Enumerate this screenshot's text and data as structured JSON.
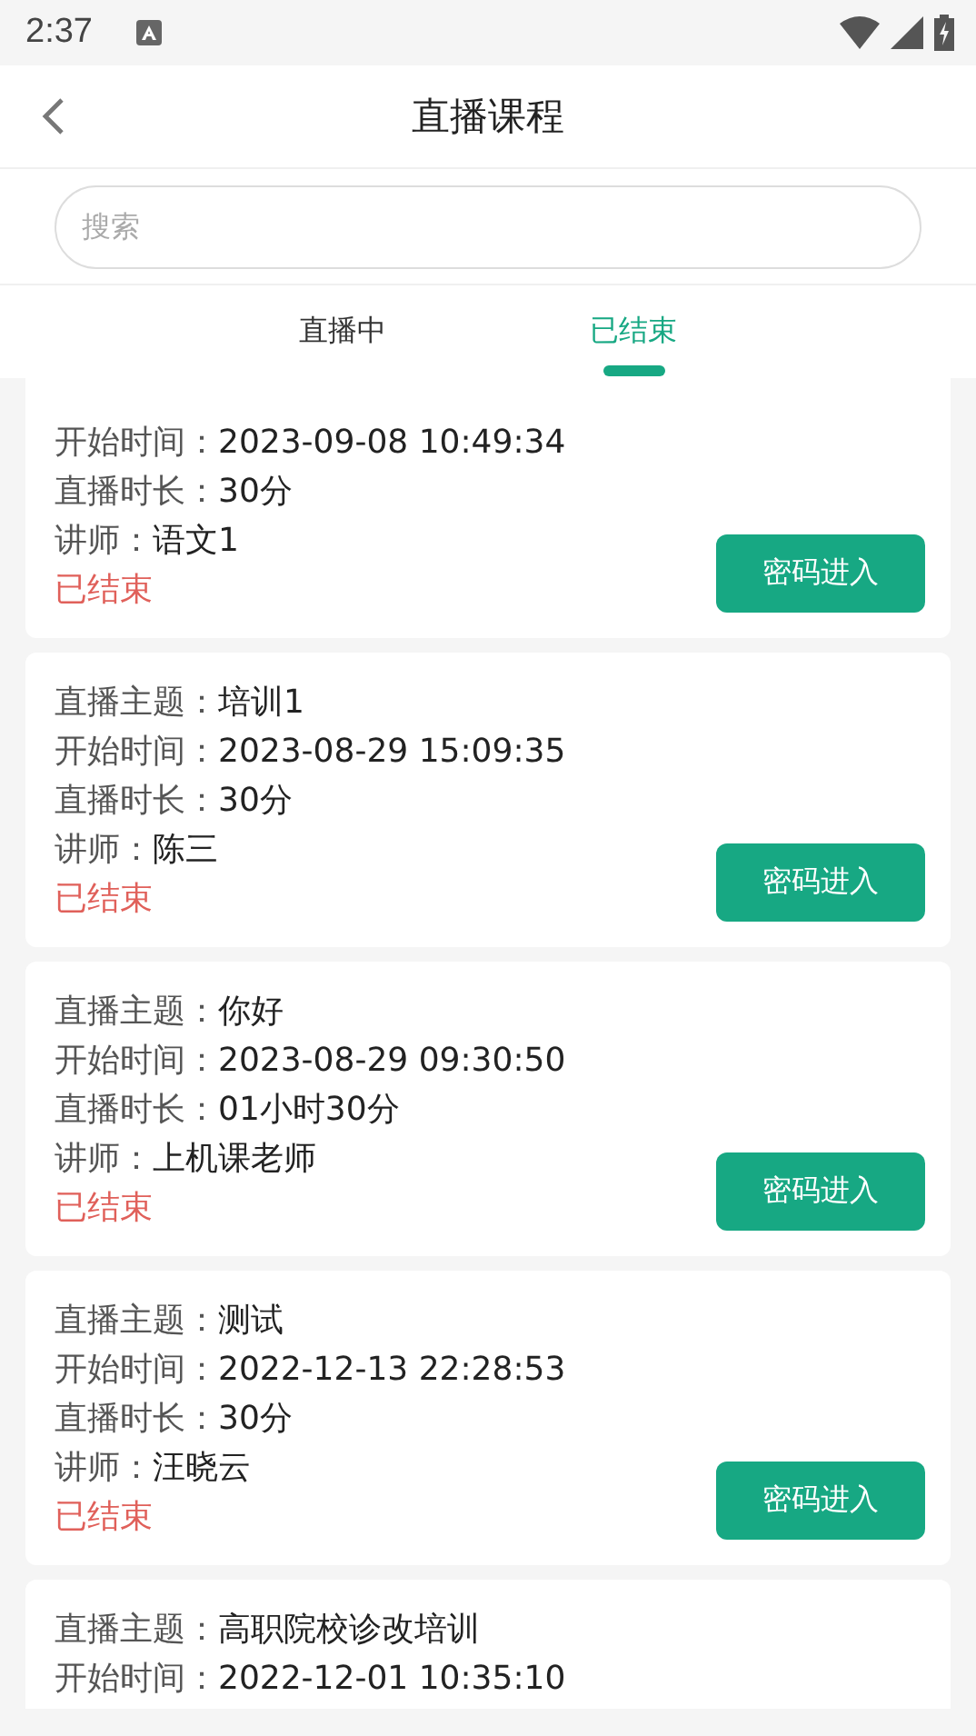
{
  "status_bar": {
    "time": "2:37"
  },
  "header": {
    "title": "直播课程"
  },
  "search": {
    "placeholder": "搜索"
  },
  "tabs": [
    {
      "label": "直播中",
      "selected": false
    },
    {
      "label": "已结束",
      "selected": true
    }
  ],
  "courses": [
    {
      "fields": [
        {
          "label": "开始时间：",
          "value": "2023-09-08 10:49:34"
        },
        {
          "label": "直播时长：",
          "value": "30分"
        },
        {
          "label": "讲师：",
          "value": "语文1"
        }
      ],
      "status": "已结束",
      "button": "密码进入"
    },
    {
      "fields": [
        {
          "label": "直播主题：",
          "value": "培训1"
        },
        {
          "label": "开始时间：",
          "value": "2023-08-29 15:09:35"
        },
        {
          "label": "直播时长：",
          "value": "30分"
        },
        {
          "label": "讲师：",
          "value": "陈三"
        }
      ],
      "status": "已结束",
      "button": "密码进入"
    },
    {
      "fields": [
        {
          "label": "直播主题：",
          "value": "你好"
        },
        {
          "label": "开始时间：",
          "value": "2023-08-29 09:30:50"
        },
        {
          "label": "直播时长：",
          "value": "01小时30分"
        },
        {
          "label": "讲师：",
          "value": "上机课老师"
        }
      ],
      "status": "已结束",
      "button": "密码进入"
    },
    {
      "fields": [
        {
          "label": "直播主题：",
          "value": "测试"
        },
        {
          "label": "开始时间：",
          "value": "2022-12-13 22:28:53"
        },
        {
          "label": "直播时长：",
          "value": "30分"
        },
        {
          "label": "讲师：",
          "value": "汪晓云"
        }
      ],
      "status": "已结束",
      "button": "密码进入"
    },
    {
      "fields": [
        {
          "label": "直播主题：",
          "value": "高职院校诊改培训"
        },
        {
          "label": "开始时间：",
          "value": "2022-12-01 10:35:10"
        }
      ]
    }
  ]
}
